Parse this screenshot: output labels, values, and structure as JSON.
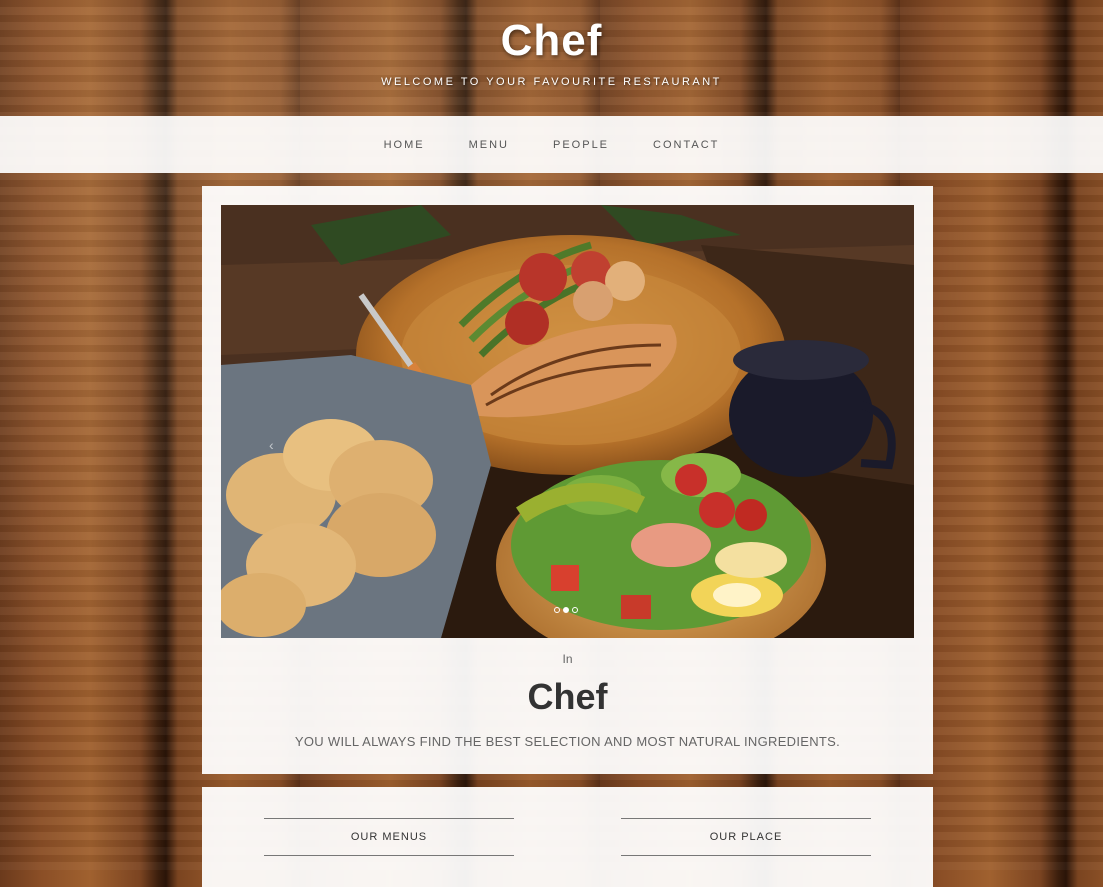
{
  "header": {
    "title": "Chef",
    "tagline": "WELCOME TO YOUR FAVOURITE RESTAURANT"
  },
  "nav": {
    "items": [
      {
        "label": "HOME"
      },
      {
        "label": "MENU"
      },
      {
        "label": "PEOPLE"
      },
      {
        "label": "CONTACT"
      }
    ]
  },
  "hero": {
    "slider": {
      "prev_icon": "chevron-left-icon",
      "dots_count": 3,
      "active_dot": 2
    },
    "intro_small": "In",
    "intro_title": "Chef",
    "intro_text": "YOU WILL ALWAYS FIND THE BEST SELECTION AND MOST NATURAL INGREDIENTS."
  },
  "sections": {
    "menus_label": "OUR MENUS",
    "place_label": "OUR PLACE"
  }
}
